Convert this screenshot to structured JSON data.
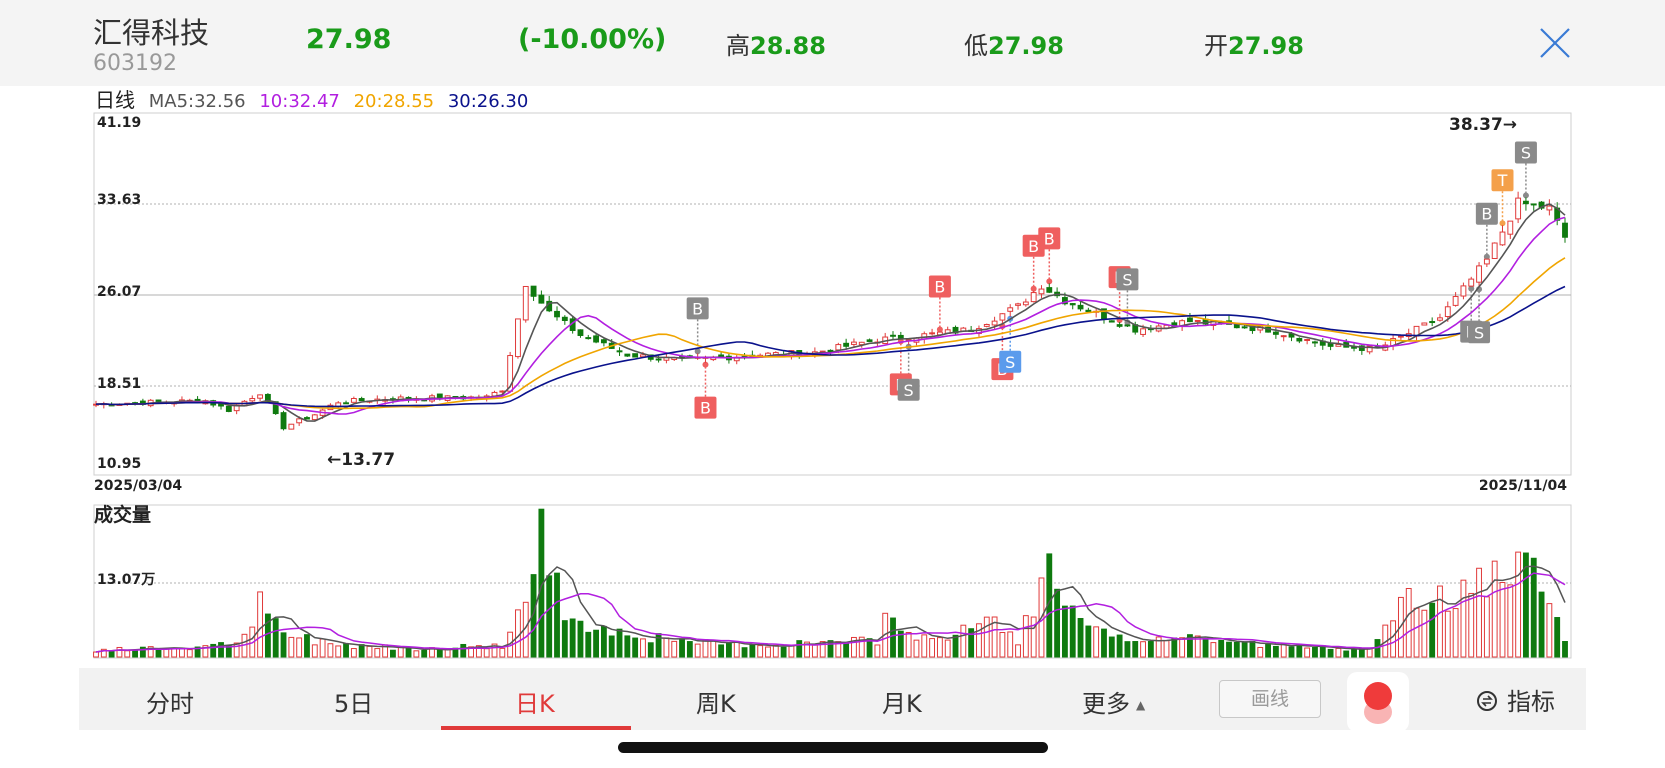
{
  "header": {
    "name": "汇得科技",
    "code": "603192",
    "price": "27.98",
    "change_pct": "(-10.00%)",
    "high_label": "高",
    "high": "28.88",
    "low_label": "低",
    "low": "27.98",
    "open_label": "开",
    "open": "27.98"
  },
  "colors": {
    "up": "#e03a3a",
    "down": "#0f7a0f",
    "ma5": "#555555",
    "ma10": "#b21fe0",
    "ma20": "#f0a500",
    "ma30": "#0a128c",
    "accent": "#e03a3a",
    "green_text": "#1a9b1a"
  },
  "legend": {
    "title": "日线",
    "ma5": "MA5:32.56",
    "ma10": "10:32.47",
    "ma20": "20:28.55",
    "ma30": "30:26.30"
  },
  "tabs": [
    {
      "label": "分时",
      "active": false
    },
    {
      "label": "5日",
      "active": false
    },
    {
      "label": "日K",
      "active": true
    },
    {
      "label": "周K",
      "active": false
    },
    {
      "label": "月K",
      "active": false
    },
    {
      "label": "更多",
      "active": false
    }
  ],
  "toolbar": {
    "draw_label": "画线",
    "indicator_label": "指标"
  },
  "chart_data": {
    "type": "candlestick",
    "title": "",
    "xlabel": "",
    "ylabel": "",
    "date_start": "2025/03/04",
    "date_end": "2025/11/04",
    "y_ticks": [
      "41.19",
      "33.63",
      "26.07",
      "18.51",
      "10.95"
    ],
    "ylim": [
      10.95,
      41.19
    ],
    "max_label": "38.37→",
    "min_label": "←13.77",
    "grid": true,
    "volume": {
      "title": "成交量",
      "tick": "13.07万",
      "tick_value": 130700
    },
    "price_anchors": [
      [
        0,
        16.5
      ],
      [
        8,
        16.7
      ],
      [
        14,
        16.8
      ],
      [
        17,
        16.0
      ],
      [
        21,
        17.5
      ],
      [
        24,
        14.5
      ],
      [
        28,
        15.6
      ],
      [
        31,
        16.7
      ],
      [
        38,
        17.0
      ],
      [
        50,
        17.1
      ],
      [
        52,
        17.8
      ],
      [
        55,
        27.0
      ],
      [
        58,
        24.5
      ],
      [
        62,
        22.5
      ],
      [
        68,
        20.8
      ],
      [
        75,
        20.3
      ],
      [
        85,
        20.8
      ],
      [
        92,
        21.0
      ],
      [
        100,
        22.1
      ],
      [
        106,
        22.5
      ],
      [
        112,
        23.0
      ],
      [
        118,
        25.0
      ],
      [
        121,
        26.8
      ],
      [
        124,
        25.5
      ],
      [
        133,
        23.0
      ],
      [
        140,
        23.7
      ],
      [
        150,
        23.0
      ],
      [
        158,
        21.5
      ],
      [
        164,
        21.3
      ],
      [
        172,
        24.0
      ],
      [
        178,
        29.0
      ],
      [
        182,
        34.0
      ],
      [
        186,
        33.5
      ],
      [
        188,
        31.0
      ]
    ],
    "volume_anchors": [
      [
        0,
        12000
      ],
      [
        15,
        18000
      ],
      [
        19,
        32000
      ],
      [
        21,
        90000
      ],
      [
        24,
        40000
      ],
      [
        30,
        24000
      ],
      [
        40,
        15000
      ],
      [
        52,
        20000
      ],
      [
        55,
        100000
      ],
      [
        57,
        204000
      ],
      [
        60,
        80000
      ],
      [
        65,
        50000
      ],
      [
        75,
        25000
      ],
      [
        85,
        22000
      ],
      [
        100,
        28000
      ],
      [
        101,
        100000
      ],
      [
        103,
        40000
      ],
      [
        110,
        35000
      ],
      [
        114,
        70000
      ],
      [
        118,
        30000
      ],
      [
        122,
        150000
      ],
      [
        124,
        80000
      ],
      [
        130,
        30000
      ],
      [
        140,
        35000
      ],
      [
        150,
        20000
      ],
      [
        160,
        15000
      ],
      [
        164,
        25000
      ],
      [
        168,
        100000
      ],
      [
        175,
        110000
      ],
      [
        180,
        150000
      ],
      [
        184,
        140000
      ],
      [
        188,
        35000
      ]
    ],
    "count": 189,
    "signals": [
      {
        "label": "B",
        "idx": 78,
        "kind": "buy",
        "dir": "below"
      },
      {
        "label": "B",
        "idx": 77,
        "kind": "gray",
        "dir": "above"
      },
      {
        "label": "B",
        "idx": 103,
        "kind": "buy",
        "dir": "below"
      },
      {
        "label": "S",
        "idx": 104,
        "kind": "gray",
        "dir": "below"
      },
      {
        "label": "B",
        "idx": 108,
        "kind": "buy",
        "dir": "above"
      },
      {
        "label": "B",
        "idx": 116,
        "kind": "buy",
        "dir": "below"
      },
      {
        "label": "S",
        "idx": 117,
        "kind": "blue",
        "dir": "below"
      },
      {
        "label": "B",
        "idx": 120,
        "kind": "buy",
        "dir": "above"
      },
      {
        "label": "B",
        "idx": 122,
        "kind": "buy",
        "dir": "above"
      },
      {
        "label": "B",
        "idx": 131,
        "kind": "buy",
        "dir": "above"
      },
      {
        "label": "S",
        "idx": 132,
        "kind": "gray",
        "dir": "above"
      },
      {
        "label": "B",
        "idx": 176,
        "kind": "gray",
        "dir": "below"
      },
      {
        "label": "S",
        "idx": 177,
        "kind": "gray",
        "dir": "below"
      },
      {
        "label": "B",
        "idx": 178,
        "kind": "gray",
        "dir": "above"
      },
      {
        "label": "T",
        "idx": 180,
        "kind": "orange",
        "dir": "above"
      },
      {
        "label": "S",
        "idx": 183,
        "kind": "gray",
        "dir": "above"
      }
    ]
  }
}
